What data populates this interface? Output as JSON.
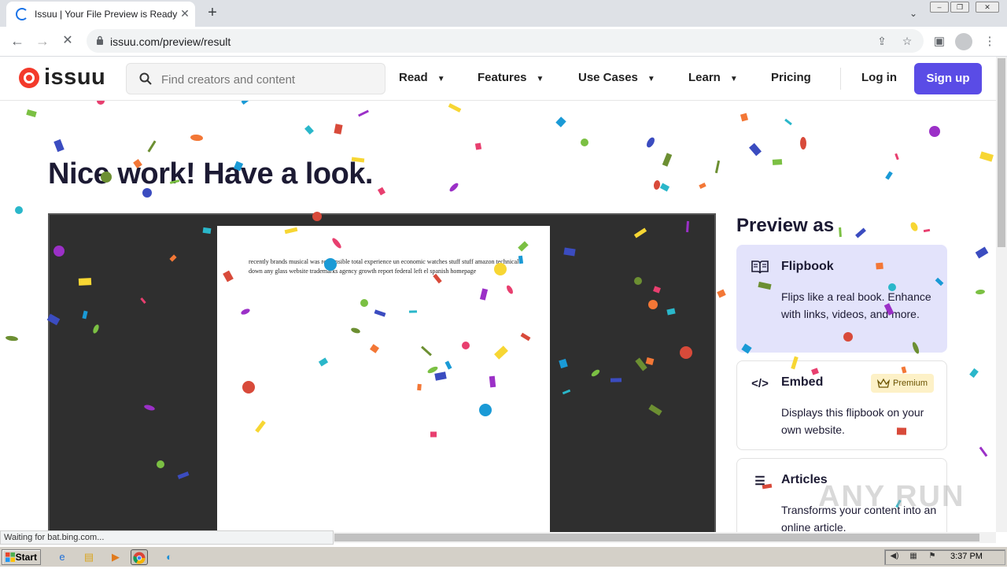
{
  "browser": {
    "tab_title": "Issuu | Your File Preview is Ready",
    "url": "issuu.com/preview/result",
    "status_text": "Waiting for bat.bing.com..."
  },
  "site": {
    "logo": "issuu",
    "search_placeholder": "Find creators and content",
    "nav": [
      "Read",
      "Features",
      "Use Cases",
      "Learn",
      "Pricing"
    ],
    "login": "Log in",
    "signup": "Sign up"
  },
  "main": {
    "headline": "Nice work! Have a look.",
    "page_text": "recently   brands musical was responsible total experience un economic  watches stuff  stuff amazon technical down any  glass website trademarks agency growth  report federal left el spanish homepage",
    "preview_title": "Preview as",
    "options": [
      {
        "icon": "book-icon",
        "title": "Flipbook",
        "desc": "Flips like a real book. Enhance with links, videos, and more."
      },
      {
        "icon": "code-icon",
        "title": "Embed",
        "desc": "Displays this flipbook on your own website.",
        "badge": "Premium"
      },
      {
        "icon": "articles-icon",
        "title": "Articles",
        "desc": "Transforms your content into an online article."
      }
    ]
  },
  "taskbar": {
    "start": "Start",
    "clock": "3:37 PM"
  },
  "watermark": "ANY RUN",
  "colors": {
    "accent": "#5a4ce6",
    "logo_red": "#f33a2b",
    "selected_bg": "#e3e3fb",
    "viewer_bg": "#2f2f2f"
  }
}
